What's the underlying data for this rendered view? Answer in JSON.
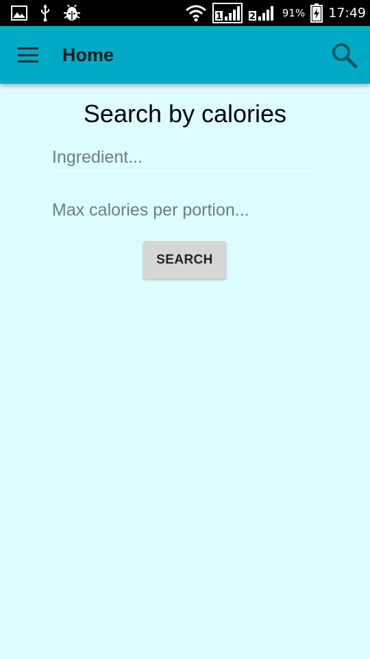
{
  "status_bar": {
    "icons_left": [
      "image-icon",
      "usb-icon",
      "bug-icon"
    ],
    "icons_right": [
      "wifi-icon",
      "sim1-signal-icon",
      "sim2-signal-icon",
      "battery-charging-icon"
    ],
    "sim1_label": "1",
    "sim2_label": "2",
    "battery": "91%",
    "time": "17:49"
  },
  "app_bar": {
    "title": "Home",
    "background": "#00aac4"
  },
  "main": {
    "heading": "Search by calories",
    "ingredient_placeholder": "Ingredient...",
    "calories_placeholder": "Max calories per portion...",
    "search_button": "SEARCH",
    "background": "#dcfcfe"
  }
}
